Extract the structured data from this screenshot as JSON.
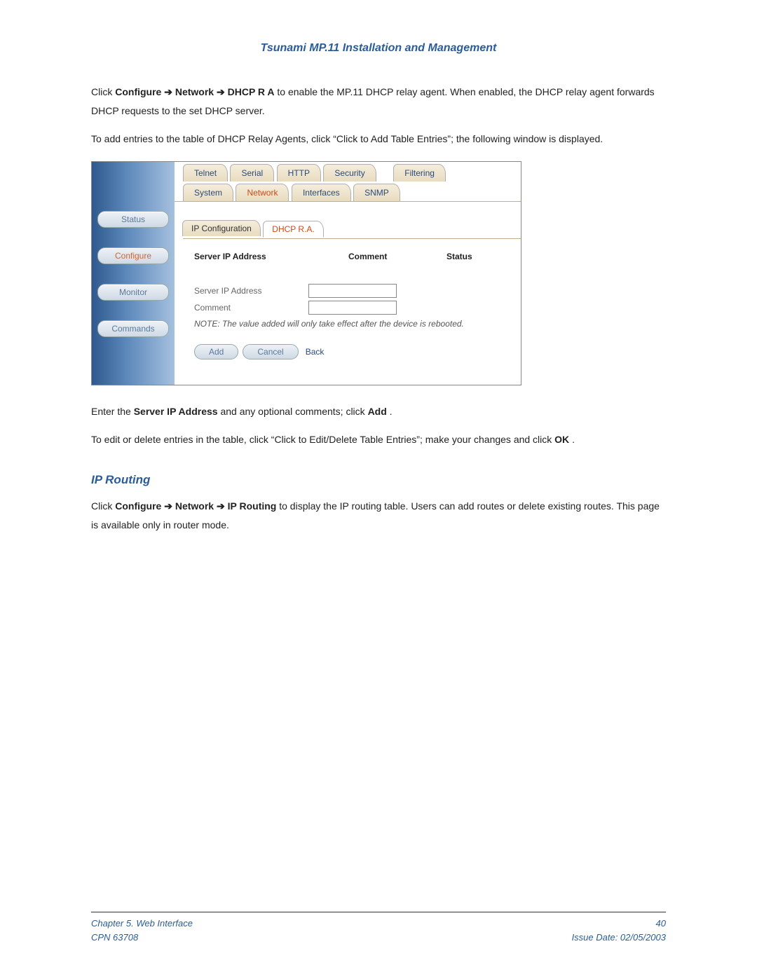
{
  "doc": {
    "title": "Tsunami MP.11 Installation and Management",
    "para1_pre": "Click ",
    "para1_b1": "Configure",
    "arrow": " ➔ ",
    "para1_b2": "Network",
    "para1_b3": "DHCP R A",
    "para1_post": " to enable the MP.11 DHCP relay agent.   When enabled, the DHCP relay agent forwards DHCP requests to the set DHCP server.",
    "para2": "To add entries to the table of DHCP Relay Agents, click “Click to Add Table Entries”; the following window is displayed.",
    "para3_pre": "Enter the ",
    "para3_b1": "Server IP Address",
    "para3_mid": " and any optional comments; click ",
    "para3_b2": "Add",
    "para3_post": ".",
    "para4_pre": "To edit or delete entries in the table, click “Click to Edit/Delete Table Entries”; make your changes and click ",
    "para4_b1": "OK",
    "para4_post": ".",
    "heading_ip_routing": "IP Routing",
    "para5_pre": "Click ",
    "para5_b1": "Configure",
    "para5_b2": "Network",
    "para5_b3": "IP Routing",
    "para5_post": " to display the IP routing table.  Users can add routes or delete existing routes.  This page is available only in router mode."
  },
  "shot": {
    "sidebar": {
      "status": "Status",
      "configure": "Configure",
      "monitor": "Monitor",
      "commands": "Commands"
    },
    "tabs_upper": [
      "Telnet",
      "Serial",
      "HTTP",
      "Security",
      "Filtering"
    ],
    "tabs_lower": [
      "System",
      "Network",
      "Interfaces",
      "SNMP"
    ],
    "active_lower": "Network",
    "subtabs": {
      "ipconfig": "IP Configuration",
      "dhcpra": "DHCP R.A."
    },
    "table": {
      "h1": "Server IP Address",
      "h2": "Comment",
      "h3": "Status"
    },
    "form": {
      "server_ip_label": "Server IP Address",
      "comment_label": "Comment",
      "note": "NOTE: The value added will only take effect after the device is rebooted."
    },
    "buttons": {
      "add": "Add",
      "cancel": "Cancel",
      "back": "Back"
    }
  },
  "footer": {
    "chapter": "Chapter 5.  Web Interface",
    "cpn": "CPN 63708",
    "page": "40",
    "issue": "Issue Date:  02/05/2003"
  }
}
